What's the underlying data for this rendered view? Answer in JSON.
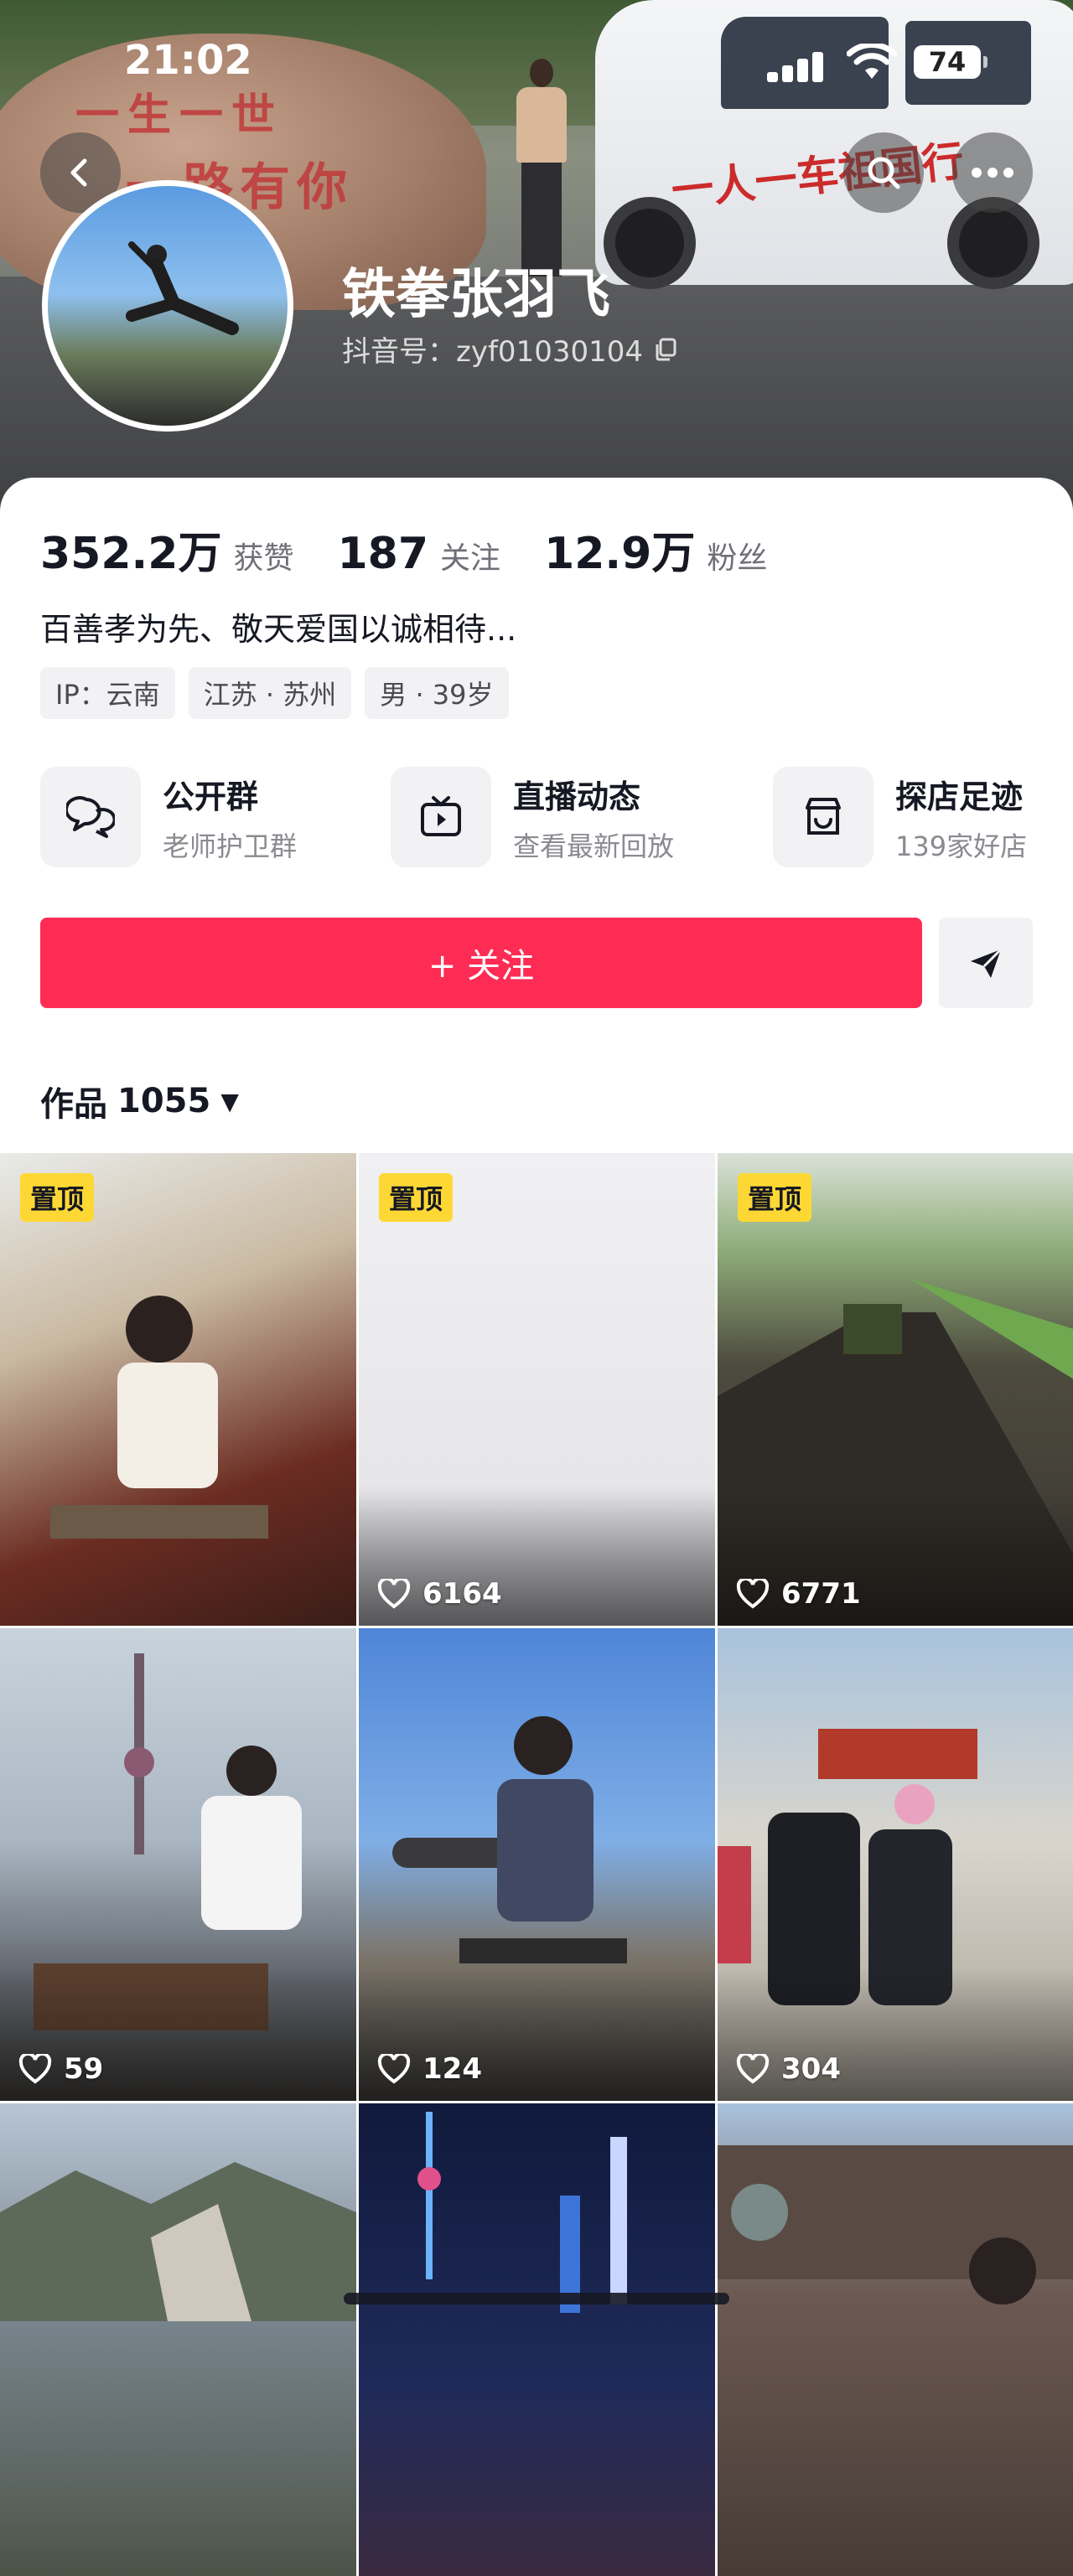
{
  "status_bar": {
    "time": "21:02",
    "battery": "74"
  },
  "banner": {
    "rock_line1": "一生一世",
    "rock_line2": "一路有你",
    "van_slogan": "一人一车祖国行"
  },
  "profile": {
    "nickname": "铁拳张羽飞",
    "douyin_id": "抖音号：zyf01030104",
    "stats": [
      {
        "value": "352.2万",
        "label": "获赞"
      },
      {
        "value": "187",
        "label": "关注"
      },
      {
        "value": "12.9万",
        "label": "粉丝"
      }
    ],
    "bio": "百善孝为先、敬天爱国以诚相待...",
    "tags": [
      "IP：云南",
      "江苏 · 苏州",
      "男 · 39岁"
    ]
  },
  "features": [
    {
      "title": "公开群",
      "subtitle": "老师护卫群",
      "icon": "group-chat-icon"
    },
    {
      "title": "直播动态",
      "subtitle": "查看最新回放",
      "icon": "live-replay-icon"
    },
    {
      "title": "探店足迹",
      "subtitle": "139家好店",
      "icon": "store-visit-icon"
    }
  ],
  "actions": {
    "follow_label": "+ 关注"
  },
  "works": {
    "tab_label": "作品",
    "count": "1055"
  },
  "videos": [
    {
      "pinned": "置顶",
      "likes": ""
    },
    {
      "pinned": "置顶",
      "likes": "6164"
    },
    {
      "pinned": "置顶",
      "likes": "6771"
    },
    {
      "pinned": "",
      "likes": "59"
    },
    {
      "pinned": "",
      "likes": "124"
    },
    {
      "pinned": "",
      "likes": "304"
    },
    {
      "pinned": "",
      "likes": ""
    },
    {
      "pinned": "",
      "likes": ""
    },
    {
      "pinned": "",
      "likes": ""
    }
  ],
  "colors": {
    "accent": "#fe2c55",
    "pin_badge": "#fdd835"
  }
}
